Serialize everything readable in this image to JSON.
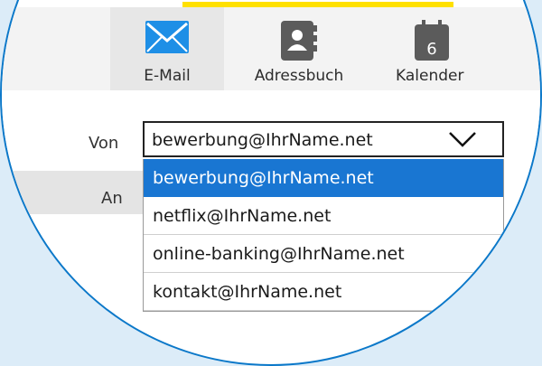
{
  "nav": {
    "items": [
      {
        "label": "E-Mail",
        "icon": "envelope-icon",
        "active": true
      },
      {
        "label": "Adressbuch",
        "icon": "address-book-icon",
        "active": false
      },
      {
        "label": "Kalender",
        "icon": "calendar-icon",
        "active": false,
        "calendar_day": "6"
      }
    ]
  },
  "form": {
    "from_label": "Von",
    "to_label": "An",
    "from_select": {
      "value": "bewerbung@IhrName.net",
      "options": [
        {
          "label": "bewerbung@IhrName.net",
          "selected": true
        },
        {
          "label": "netflix@IhrName.net",
          "selected": false
        },
        {
          "label": "online-banking@IhrName.net",
          "selected": false
        },
        {
          "label": "kontakt@IhrName.net",
          "selected": false
        }
      ]
    }
  },
  "colors": {
    "accent": "#1976d2",
    "icon_blue": "#1e8fe6",
    "icon_gray": "#5b5b5b",
    "top_strip": "#ffe000",
    "lens_border": "#0b78c9",
    "backdrop": "#dcecf8"
  }
}
